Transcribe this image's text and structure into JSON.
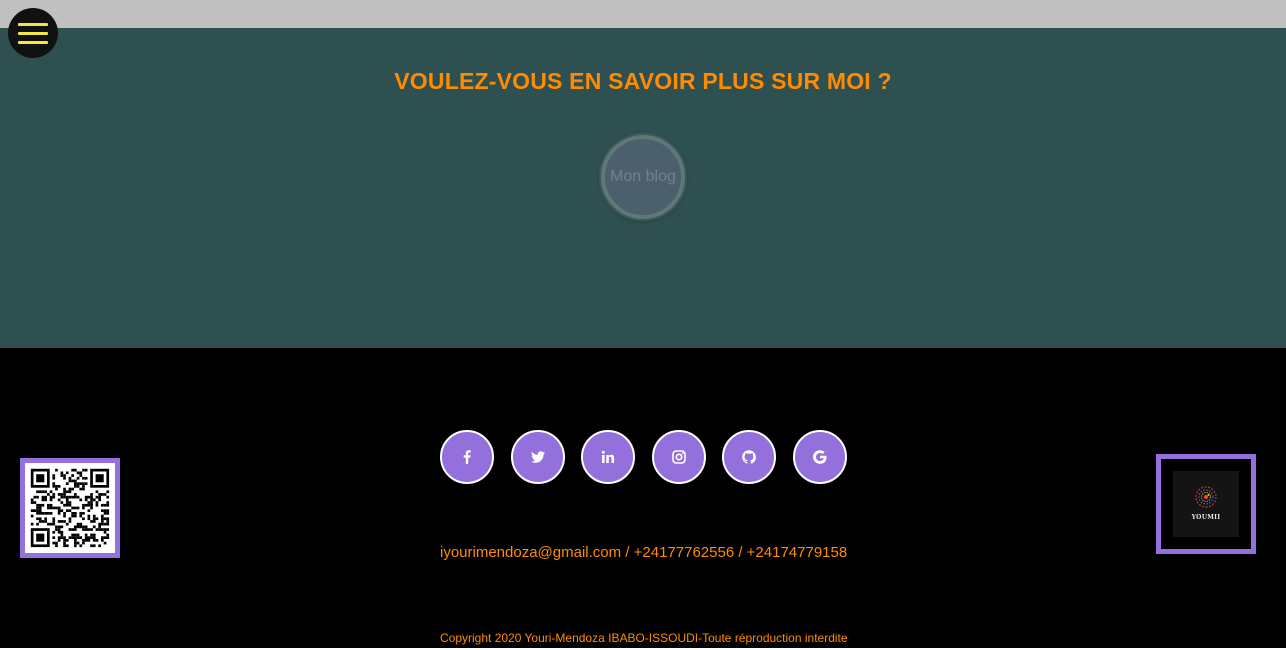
{
  "menu": {
    "icon": "hamburger-menu-icon",
    "accent": "#f5e642"
  },
  "hero": {
    "title": "VOULEZ-VOUS EN SAVOIR PLUS SUR MOI ?",
    "blog_button_label": "Mon blog",
    "background": "#2f5050",
    "title_color": "#ff8c00"
  },
  "footer": {
    "social_links": [
      {
        "icon": "facebook-icon"
      },
      {
        "icon": "twitter-icon"
      },
      {
        "icon": "linkedin-icon"
      },
      {
        "icon": "instagram-icon"
      },
      {
        "icon": "github-icon"
      },
      {
        "icon": "google-icon"
      }
    ],
    "contact": "iyourimendoza@gmail.com / +24177762556 / +24174779158",
    "copyright": "Copyright 2020 Youri-Mendoza IBABO-ISSOUDI-Toute réproduction interdite",
    "qr_code": "qr-code-image",
    "logo": {
      "text": "YOUMII",
      "icon": "brand-logo"
    },
    "accent": "#9370db",
    "text_color": "#ff8c00"
  }
}
